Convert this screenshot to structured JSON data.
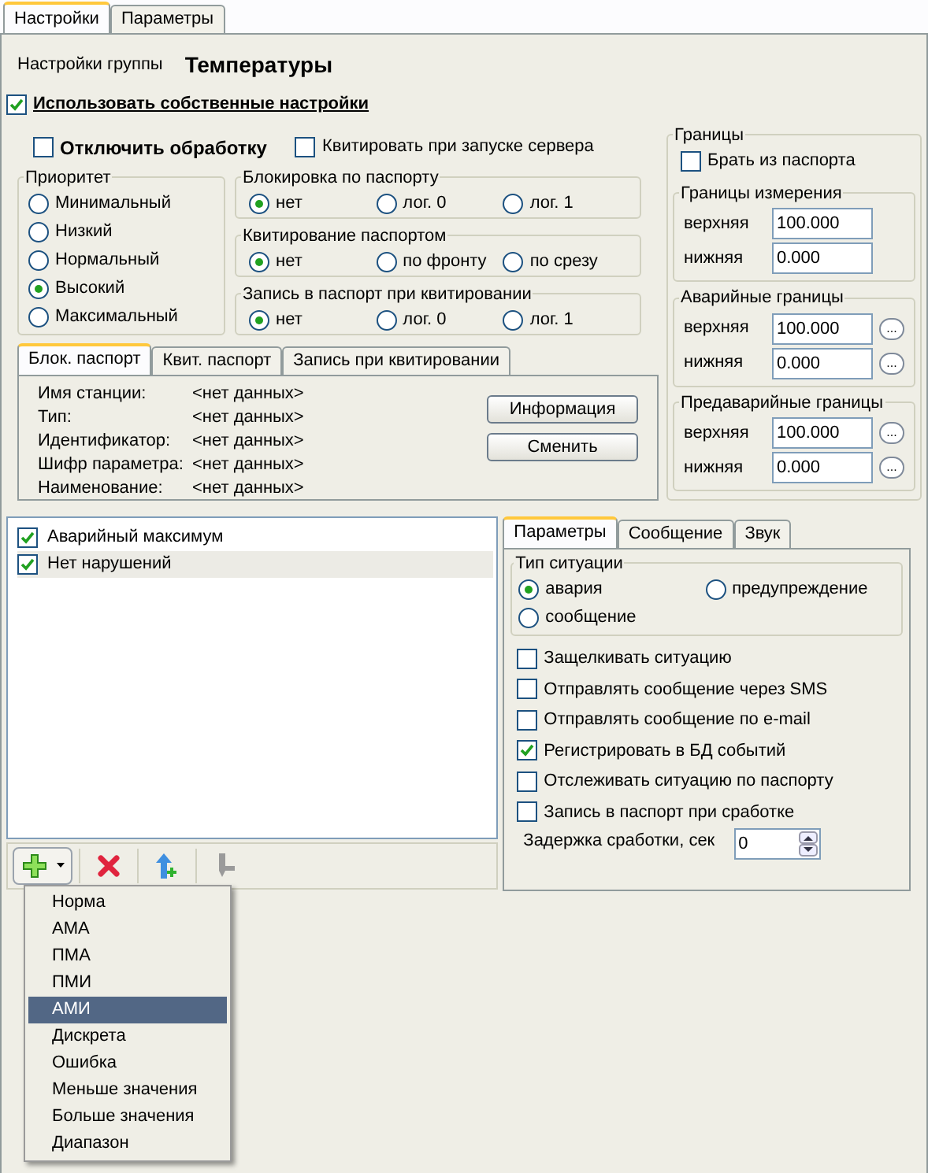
{
  "tabs": [
    {
      "label": "Настройки",
      "selected": true
    },
    {
      "label": "Параметры",
      "selected": false
    }
  ],
  "group": {
    "label": "Настройки группы",
    "name": "Температуры"
  },
  "use_own": {
    "label": "Использовать собственные настройки",
    "checked": true
  },
  "disable_processing": {
    "label": "Отключить обработку",
    "checked": false
  },
  "ack_on_start": {
    "label": "Квитировать при запуске сервера",
    "checked": false
  },
  "priority": {
    "title": "Приоритет",
    "options": [
      {
        "label": "Минимальный",
        "selected": false
      },
      {
        "label": "Низкий",
        "selected": false
      },
      {
        "label": "Нормальный",
        "selected": false
      },
      {
        "label": "Высокий",
        "selected": true
      },
      {
        "label": "Максимальный",
        "selected": false
      }
    ]
  },
  "radio_groups": [
    {
      "title": "Блокировка по паспорту",
      "options": [
        {
          "label": "нет",
          "selected": true
        },
        {
          "label": "лог. 0",
          "selected": false
        },
        {
          "label": "лог. 1",
          "selected": false
        }
      ]
    },
    {
      "title": "Квитирование паспортом",
      "options": [
        {
          "label": "нет",
          "selected": true
        },
        {
          "label": "по фронту",
          "selected": false
        },
        {
          "label": "по срезу",
          "selected": false
        }
      ]
    },
    {
      "title": "Запись в паспорт при квитировании",
      "options": [
        {
          "label": "нет",
          "selected": true
        },
        {
          "label": "лог. 0",
          "selected": false
        },
        {
          "label": "лог. 1",
          "selected": false
        }
      ]
    }
  ],
  "passport_tabs": [
    {
      "label": "Блок. паспорт",
      "selected": true
    },
    {
      "label": "Квит. паспорт",
      "selected": false
    },
    {
      "label": "Запись при квитировании",
      "selected": false
    }
  ],
  "passport_fields": [
    {
      "label": "Имя станции:",
      "value": "<нет данных>"
    },
    {
      "label": "Тип:",
      "value": "<нет данных>"
    },
    {
      "label": "Идентификатор:",
      "value": "<нет данных>"
    },
    {
      "label": "Шифр параметра:",
      "value": "<нет данных>"
    },
    {
      "label": "Наименование:",
      "value": "<нет данных>"
    }
  ],
  "passport_buttons": [
    "Информация",
    "Сменить"
  ],
  "limits": {
    "title": "Границы",
    "from_passport": {
      "label": "Брать из паспорта",
      "checked": false
    },
    "groups": [
      {
        "title": "Границы измерения",
        "rows": [
          {
            "label": "верхняя",
            "value": "100.000"
          },
          {
            "label": "нижняя",
            "value": "0.000"
          }
        ]
      },
      {
        "title": "Аварийные границы",
        "rows": [
          {
            "label": "верхняя",
            "value": "100.000",
            "button": "..."
          },
          {
            "label": "нижняя",
            "value": "0.000",
            "button": "..."
          }
        ]
      },
      {
        "title": "Предаварийные границы",
        "rows": [
          {
            "label": "верхняя",
            "value": "100.000",
            "button": "..."
          },
          {
            "label": "нижняя",
            "value": "0.000",
            "button": "..."
          }
        ]
      }
    ]
  },
  "situations": [
    {
      "label": "Аварийный максимум",
      "checked": true,
      "selected": false
    },
    {
      "label": "Нет нарушений",
      "checked": true,
      "selected": true
    }
  ],
  "toolbar": [
    {
      "kind": "add",
      "disabled": false
    },
    {
      "kind": "delete",
      "disabled": false
    },
    {
      "kind": "up",
      "disabled": false
    },
    {
      "kind": "down",
      "disabled": true
    }
  ],
  "add_menu": [
    {
      "label": "Норма",
      "selected": false
    },
    {
      "label": "АМА",
      "selected": false
    },
    {
      "label": "ПМА",
      "selected": false
    },
    {
      "label": "ПМИ",
      "selected": false
    },
    {
      "label": "АМИ",
      "selected": true
    },
    {
      "label": "Дискрета",
      "selected": false
    },
    {
      "label": "Ошибка",
      "selected": false
    },
    {
      "label": "Меньше значения",
      "selected": false
    },
    {
      "label": "Больше значения",
      "selected": false
    },
    {
      "label": "Диапазон",
      "selected": false
    }
  ],
  "detail_tabs": [
    {
      "label": "Параметры",
      "selected": true
    },
    {
      "label": "Сообщение",
      "selected": false
    },
    {
      "label": "Звук",
      "selected": false
    }
  ],
  "situation_type": {
    "title": "Тип ситуации",
    "options": [
      {
        "label": "авария",
        "selected": true
      },
      {
        "label": "предупреждение",
        "selected": false
      },
      {
        "label": "сообщение",
        "selected": false
      }
    ]
  },
  "options": [
    {
      "label": "Защелкивать ситуацию",
      "checked": false
    },
    {
      "label": "Отправлять сообщение через SMS",
      "checked": false
    },
    {
      "label": "Отправлять сообщение по e-mail",
      "checked": false
    },
    {
      "label": "Регистрировать в БД событий",
      "checked": true
    },
    {
      "label": "Отслеживать ситуацию по паспорту",
      "checked": false
    },
    {
      "label": "Запись в паспорт при сработке",
      "checked": false
    }
  ],
  "delay": {
    "label": "Задержка сработки, сек",
    "value": "0"
  }
}
